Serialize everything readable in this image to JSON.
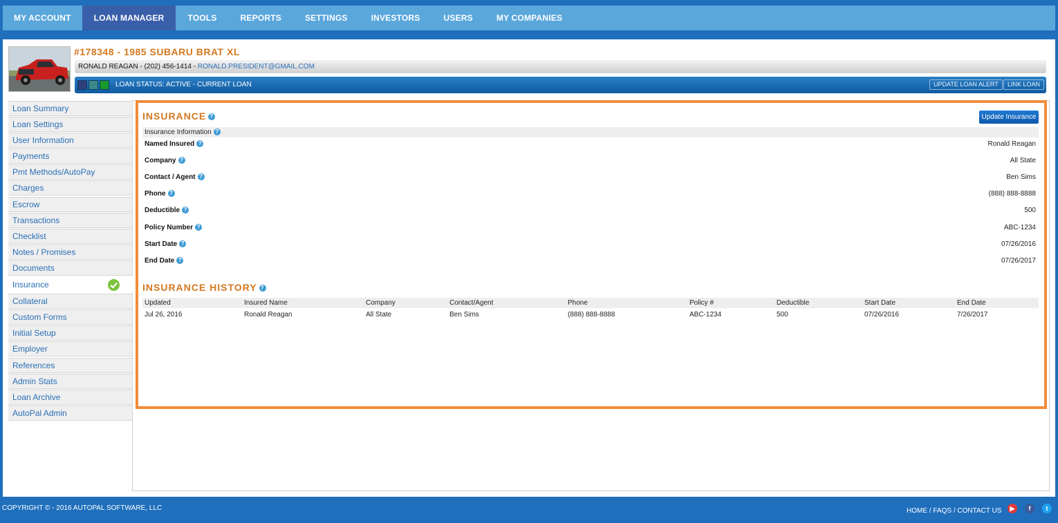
{
  "nav": {
    "items": [
      "MY ACCOUNT",
      "LOAN MANAGER",
      "TOOLS",
      "REPORTS",
      "SETTINGS",
      "INVESTORS",
      "USERS",
      "MY COMPANIES"
    ],
    "active": "LOAN MANAGER"
  },
  "loan": {
    "title": "#178348 - 1985 SUBARU BRAT XL",
    "contact_name": "RONALD REAGAN - (202) 456-1414 - ",
    "contact_email": "RONALD.PRESIDENT@GMAIL.COM",
    "status": "LOAN STATUS: ACTIVE - CURRENT LOAN",
    "status_colors": [
      "#2e3f7a",
      "#3a8a8a",
      "#1a9a2a"
    ],
    "update_alert_label": "UPDATE LOAN ALERT",
    "link_loan_label": "LINK LOAN"
  },
  "sidebar": {
    "items": [
      "Loan Summary",
      "Loan Settings",
      "User Information",
      "Payments",
      "Pmt Methods/AutoPay",
      "Charges",
      "Escrow",
      "Transactions",
      "Checklist",
      "Notes / Promises",
      "Documents",
      "Insurance",
      "Collateral",
      "Custom Forms",
      "Initial Setup",
      "Employer",
      "References",
      "Admin Stats",
      "Loan Archive",
      "AutoPal Admin"
    ],
    "active": "Insurance"
  },
  "insurance": {
    "title": "INSURANCE",
    "update_button": "Update Insurance",
    "info_header": "Insurance Information",
    "fields": [
      {
        "label": "Named Insured",
        "value": "Ronald Reagan"
      },
      {
        "label": "Company",
        "value": "All State"
      },
      {
        "label": "Contact / Agent",
        "value": "Ben Sims"
      },
      {
        "label": "Phone",
        "value": "(888) 888-8888"
      },
      {
        "label": "Deductible",
        "value": "500"
      },
      {
        "label": "Policy Number",
        "value": "ABC-1234"
      },
      {
        "label": "Start Date",
        "value": "07/26/2016"
      },
      {
        "label": "End Date",
        "value": "07/26/2017"
      }
    ]
  },
  "history": {
    "title": "INSURANCE HISTORY",
    "columns": [
      "Updated",
      "Insured Name",
      "Company",
      "Contact/Agent",
      "Phone",
      "Policy #",
      "Deductible",
      "Start Date",
      "End Date"
    ],
    "rows": [
      [
        "Jul 26, 2016",
        "Ronald Reagan",
        "All State",
        "Ben Sims",
        "(888) 888-8888",
        "ABC-1234",
        "500",
        "07/26/2016",
        "7/26/2017"
      ]
    ]
  },
  "footer": {
    "copyright": "COPYRIGHT © - 2016 AUTOPAL SOFTWARE, LLC",
    "links": [
      "HOME",
      "FAQS",
      "CONTACT US"
    ],
    "social": [
      {
        "name": "youtube",
        "color": "#e03a3a"
      },
      {
        "name": "facebook",
        "color": "#3b5998"
      },
      {
        "name": "twitter",
        "color": "#1da1f2"
      }
    ]
  }
}
